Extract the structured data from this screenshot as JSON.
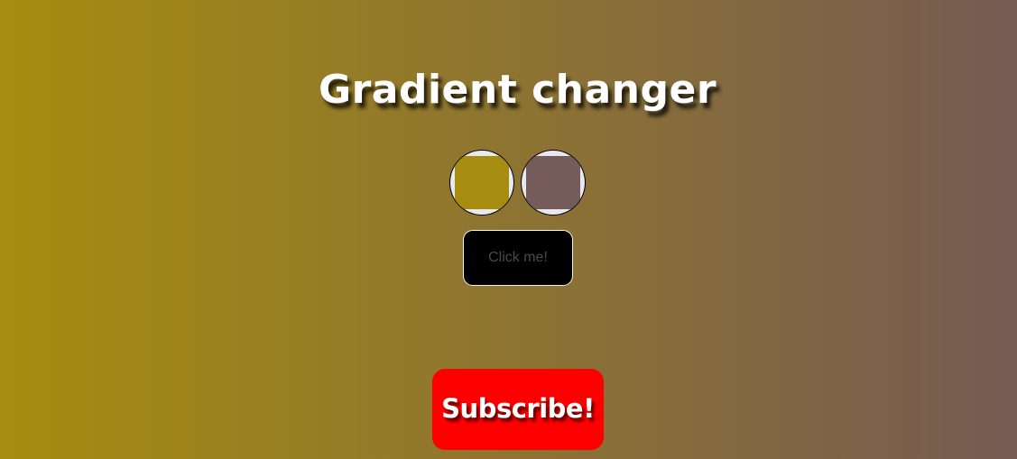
{
  "page": {
    "title": "Gradient changer",
    "gradient_start_color": "#a68d0f",
    "gradient_end_color": "#755b53"
  },
  "color_pickers": [
    {
      "name": "color-1",
      "value": "#a68d0f"
    },
    {
      "name": "color-2",
      "value": "#755b5a"
    }
  ],
  "actions": {
    "click_label": "Click me!",
    "subscribe_label": "Subscribe!",
    "subscribe_color": "#ff0000"
  }
}
